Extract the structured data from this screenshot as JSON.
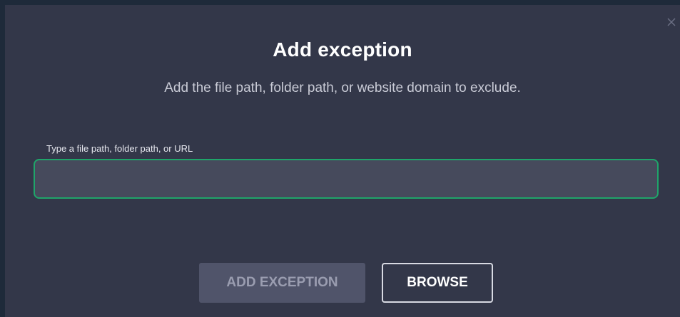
{
  "dialog": {
    "title": "Add exception",
    "subtitle": "Add the file path, folder path, or website domain to exclude.",
    "input": {
      "label": "Type a file path, folder path, or URL",
      "value": "",
      "placeholder": ""
    },
    "buttons": {
      "add_label": "ADD EXCEPTION",
      "browse_label": "BROWSE"
    },
    "close_icon": "close-icon"
  },
  "colors": {
    "background": "#333749",
    "input_border_focus": "#1fa56a",
    "input_fill": "#464a5c",
    "disabled_button": "#50546a"
  }
}
